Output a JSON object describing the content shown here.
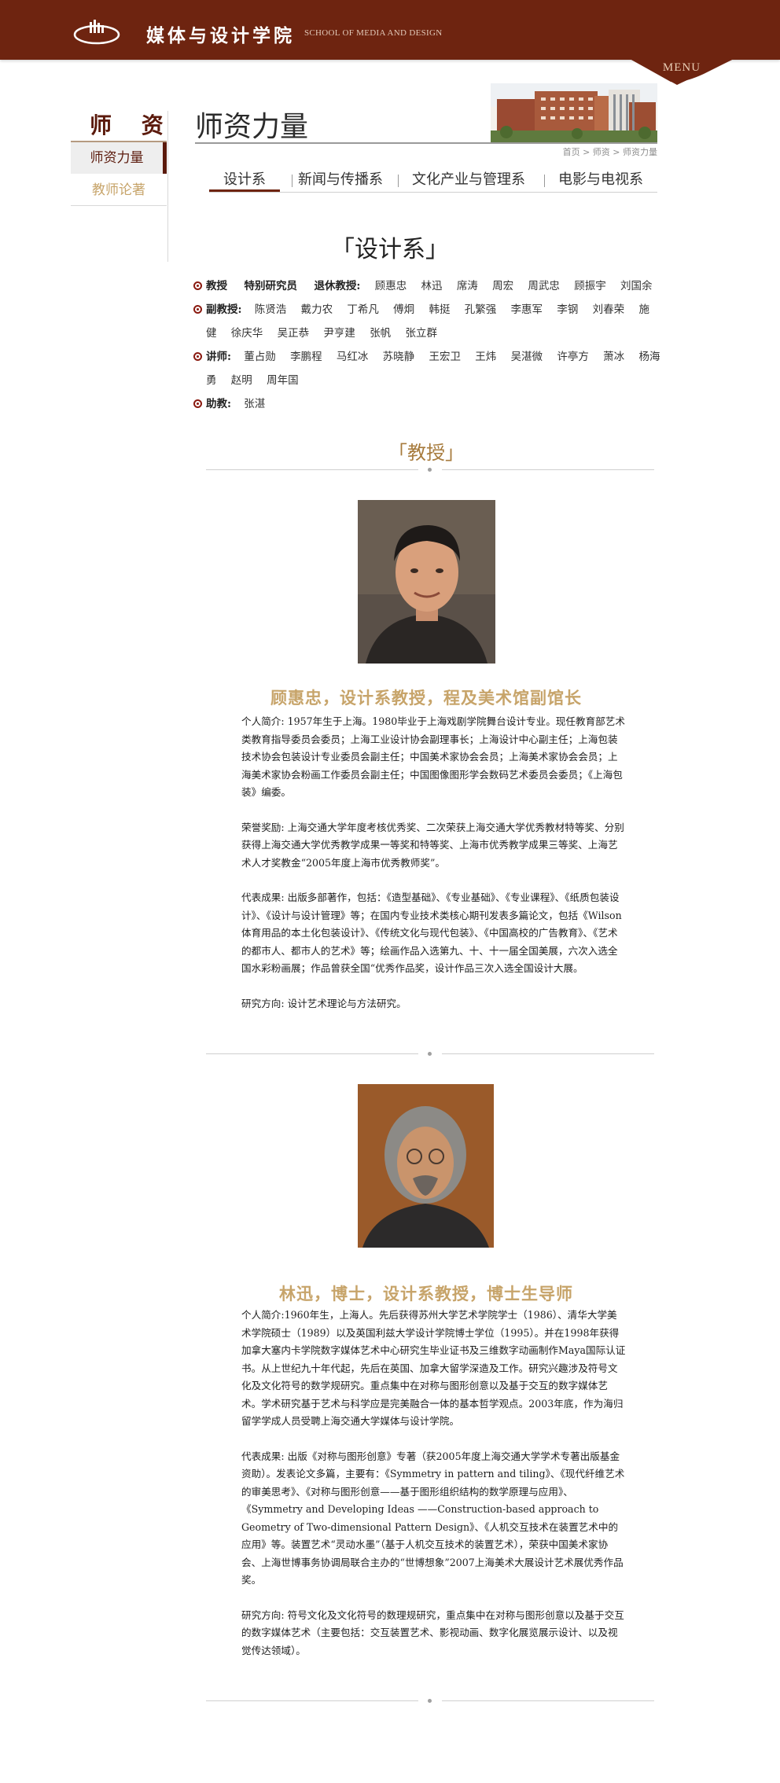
{
  "header": {
    "brand_cn": "媒体与设计学院",
    "brand_en": "SCHOOL OF MEDIA AND DESIGN",
    "menu_label": "MENU",
    "logo_icon": "building-logo-icon"
  },
  "sidebar": {
    "title": "师 资",
    "items": [
      {
        "label": "师资力量",
        "active": true
      },
      {
        "label": "教师论著",
        "active": false
      }
    ]
  },
  "page": {
    "title": "师资力量",
    "breadcrumb": [
      "首页",
      "师资",
      "师资力量"
    ],
    "breadcrumb_text": "首页 > 师资 > 师资力量"
  },
  "tabs": [
    {
      "label": "设计系",
      "active": true
    },
    {
      "label": "新闻与传播系",
      "active": false
    },
    {
      "label": "文化产业与管理系",
      "active": false
    },
    {
      "label": "电影与电视系",
      "active": false
    }
  ],
  "department": {
    "heading": "设计系",
    "roster": [
      {
        "label": "教授",
        "extra": [
          "特别研究员",
          "退休教授:"
        ],
        "names": [
          "顾惠忠",
          "林迅",
          "席涛",
          "周宏",
          "周武忠",
          "顾振宇",
          "刘国余"
        ]
      },
      {
        "label": "副教授:",
        "names": [
          "陈贤浩",
          "戴力农",
          "丁希凡",
          "傅炯",
          "韩挺",
          "孔繁强",
          "李惠军",
          "李钢",
          "刘春荣",
          "施健",
          "徐庆华",
          "吴正恭",
          "尹亨建",
          "张帆",
          "张立群"
        ]
      },
      {
        "label": "讲师:",
        "names": [
          "董占勋",
          "李鹏程",
          "马红冰",
          "苏晓静",
          "王宏卫",
          "王炜",
          "吴湛微",
          "许亭方",
          "萧冰",
          "杨海勇",
          "赵明",
          "周年国"
        ]
      },
      {
        "label": "助教:",
        "names": [
          "张湛"
        ]
      }
    ]
  },
  "section_title": "教授",
  "profiles": [
    {
      "name": "顾惠忠，设计系教授，程及美术馆副馆长",
      "paragraphs": [
        "个人简介: 1957年生于上海。1980毕业于上海戏剧学院舞台设计专业。现任教育部艺术类教育指导委员会委员；上海工业设计协会副理事长；上海设计中心副主任；上海包装技术协会包装设计专业委员会副主任；中国美术家协会会员；上海美术家协会会员；上海美术家协会粉画工作委员会副主任；中国图像图形学会数码艺术委员会委员；《上海包装》编委。",
        "荣誉奖励: 上海交通大学年度考核优秀奖、二次荣获上海交通大学优秀教材特等奖、分别获得上海交通大学优秀教学成果一等奖和特等奖、上海市优秀教学成果三等奖、上海艺术人才奖教金“2005年度上海市优秀教师奖”。",
        "代表成果: 出版多部著作，包括：《造型基础》、《专业基础》、《专业课程》、《纸质包装设计》、《设计与设计管理》等；在国内专业技术类核心期刊发表多篇论文，包括《Wilson体育用品的本土化包装设计》、《传统文化与现代包装》、《中国高校的广告教育》、《艺术的都市人、都市人的艺术》等；绘画作品入选第九、十、十一届全国美展，六次入选全国水彩粉画展；作品曾获全国“优秀作品奖，设计作品三次入选全国设计大展。",
        "研究方向: 设计艺术理论与方法研究。"
      ]
    },
    {
      "name": "林迅，博士，设计系教授，博士生导师",
      "paragraphs": [
        "个人简介:1960年生，上海人。先后获得苏州大学艺术学院学士（1986）、清华大学美术学院硕士（1989）以及英国利兹大学设计学院博士学位（1995）。并在1998年获得加拿大塞内卡学院数字媒体艺术中心研究生毕业证书及三维数字动画制作Maya国际认证书。从上世纪九十年代起，先后在英国、加拿大留学深造及工作。研究兴趣涉及符号文化及文化符号的数学规研究。重点集中在对称与图形创意以及基于交互的数字媒体艺术。学术研究基于艺术与科学应是完美融合一体的基本哲学观点。2003年底，作为海归留学学成人员受聘上海交通大学媒体与设计学院。",
        "代表成果: 出版《对称与图形创意》专著（获2005年度上海交通大学学术专著出版基金资助）。发表论文多篇，主要有：《Symmetry in pattern and tiling》、《现代纤维艺术的审美思考》、《对称与图形创意——基于图形组织结构的数学原理与应用》、《Symmetry and Developing Ideas ——Construction-based approach to Geometry of Two-dimensional Pattern Design》、《人机交互技术在装置艺术中的应用》等。装置艺术“灵动水墨”（基于人机交互技术的装置艺术），荣获中国美术家协会、上海世博事务协调局联合主办的“世博想象”2007上海美术大展设计艺术展优秀作品奖。",
        "研究方向: 符号文化及文化符号的数理规研究，重点集中在对称与图形创意以及基于交互的数字媒体艺术（主要包括：交互装置艺术、影视动画、数字化展览展示设计、以及视觉传达领域）。"
      ]
    }
  ],
  "colors": {
    "header_bg": "#6e2410",
    "accent_gold": "#c7a46a",
    "bullet_red": "#8a1a10"
  }
}
